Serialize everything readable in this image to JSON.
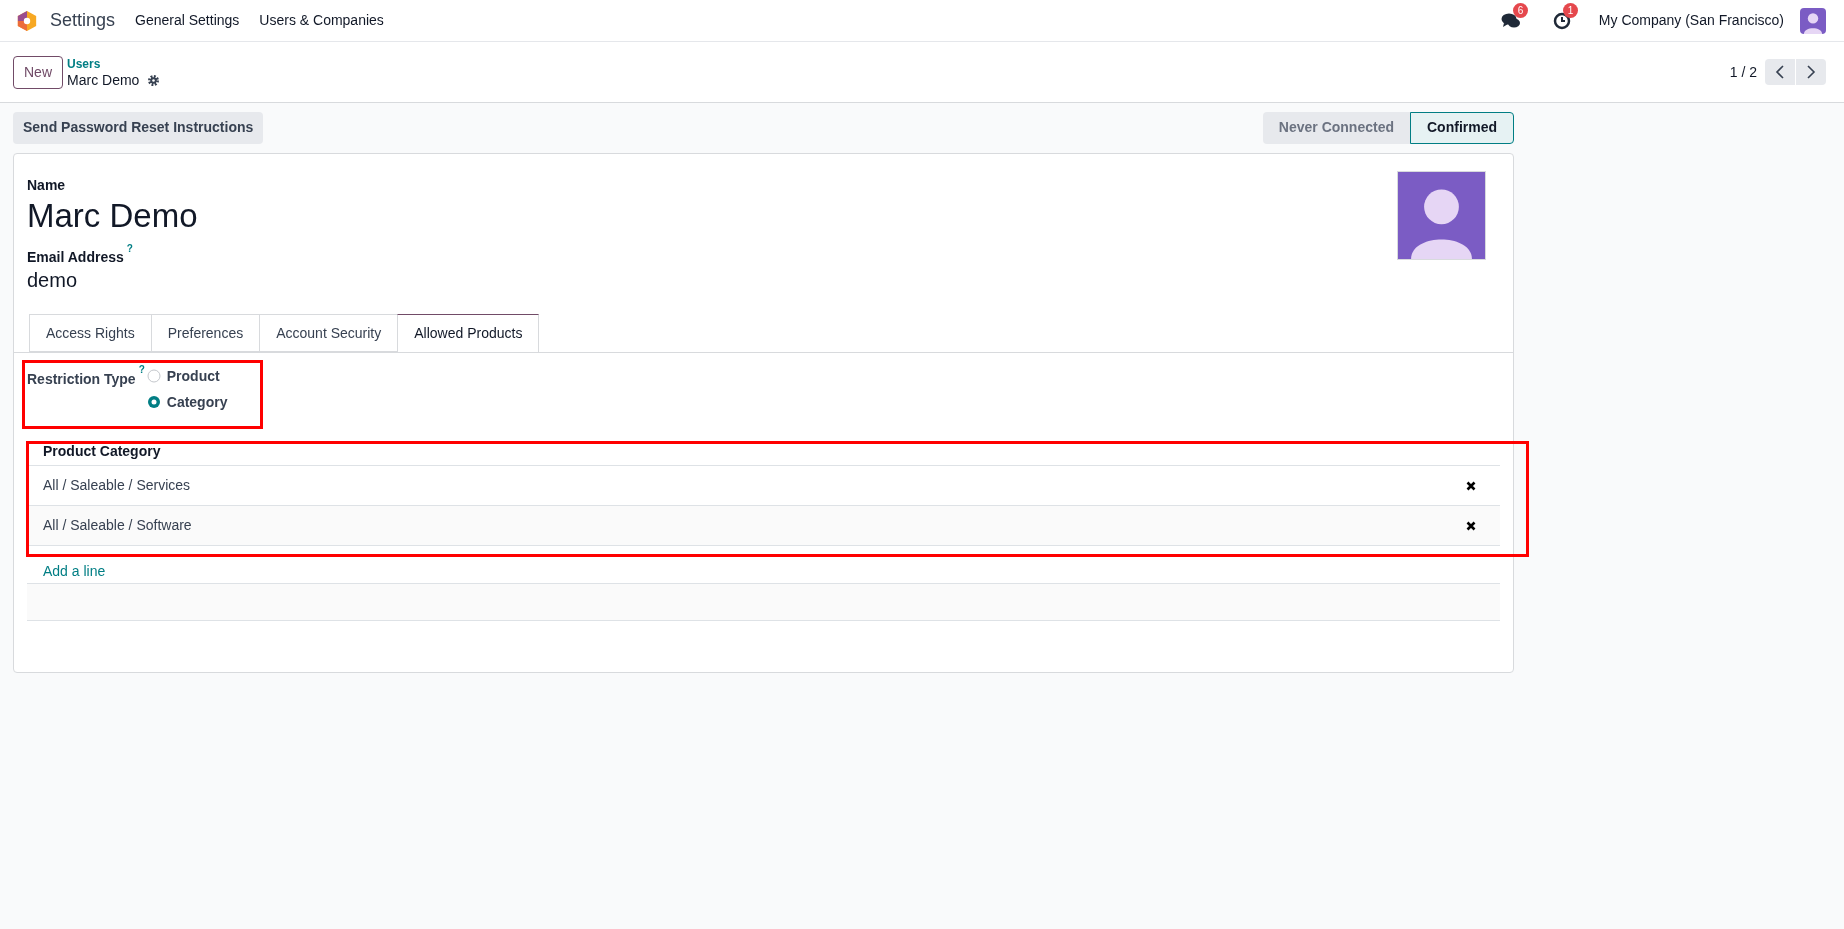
{
  "app": {
    "name": "Settings",
    "menu": [
      "General Settings",
      "Users & Companies"
    ]
  },
  "systray": {
    "messages_count": "6",
    "activities_count": "1",
    "company": "My Company (San Francisco)"
  },
  "breadcrumb": {
    "new_button": "New",
    "parent": "Users",
    "current": "Marc Demo"
  },
  "pager": {
    "value": "1 / 2"
  },
  "actions": [
    "Send Password Reset Instructions"
  ],
  "status_stages": [
    {
      "label": "Never Connected",
      "selected": false
    },
    {
      "label": "Confirmed",
      "selected": true
    }
  ],
  "form": {
    "name_label": "Name",
    "name": "Marc Demo",
    "email_label": "Email Address",
    "email_help": "?",
    "email": "demo"
  },
  "tabs": [
    {
      "label": "Access Rights",
      "selected": false
    },
    {
      "label": "Preferences",
      "selected": false
    },
    {
      "label": "Account Security",
      "selected": false
    },
    {
      "label": "Allowed Products",
      "selected": true
    }
  ],
  "restriction": {
    "label": "Restriction Type",
    "help": "?",
    "options": [
      {
        "label": "Product",
        "selected": false
      },
      {
        "label": "Category",
        "selected": true
      }
    ]
  },
  "table": {
    "columns": [
      "Product Category"
    ],
    "rows": [
      {
        "cells": [
          "All / Saleable / Services"
        ]
      },
      {
        "cells": [
          "All / Saleable / Software"
        ]
      }
    ],
    "add_line": "Add a line"
  }
}
